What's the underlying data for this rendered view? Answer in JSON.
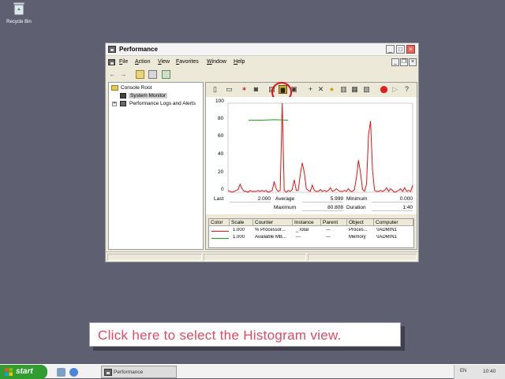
{
  "desktop": {
    "recycle_bin_label": "Recycle Bin"
  },
  "window": {
    "title": "Performance",
    "controls": {
      "minimize": "_",
      "maximize": "□",
      "close": "×"
    }
  },
  "menu": [
    "File",
    "Action",
    "View",
    "Favorites",
    "Window",
    "Help"
  ],
  "tree": {
    "root": "Console Root",
    "items": [
      "System Monitor",
      "Performance Logs and Alerts"
    ]
  },
  "chart": {
    "y_ticks": [
      "100",
      "80",
      "60",
      "40",
      "20",
      "0"
    ],
    "series_colors": {
      "processor": "#e81010",
      "memory": "#1aa31a"
    }
  },
  "chart_data": {
    "type": "line",
    "ylim": [
      0,
      100
    ],
    "series": [
      {
        "name": "% Processor...",
        "values": [
          2,
          1,
          0,
          1,
          2,
          3,
          9,
          4,
          1,
          1,
          0,
          2,
          1,
          1,
          1,
          2,
          1,
          2,
          1,
          2,
          0,
          1,
          2,
          12,
          4,
          1,
          2,
          100,
          2,
          0,
          2,
          1,
          3,
          14,
          2,
          2,
          20,
          33,
          22,
          4,
          2,
          1,
          8,
          2,
          1,
          1,
          3,
          1,
          2,
          1,
          2,
          5,
          1,
          2,
          4,
          2,
          1,
          1,
          2,
          1,
          4,
          1,
          1,
          3,
          17,
          36,
          22,
          3,
          1,
          9,
          64,
          80,
          25,
          2,
          1,
          1,
          2,
          1,
          2,
          5,
          1,
          4,
          2,
          0,
          1,
          2,
          4,
          1,
          5,
          1,
          2,
          1,
          8
        ]
      },
      {
        "name": "Available MB...",
        "values": [
          null,
          null,
          null,
          null,
          null,
          null,
          null,
          null,
          null,
          null,
          null,
          null,
          null,
          null,
          null,
          null,
          null,
          null,
          null,
          null,
          null,
          null,
          null,
          null,
          null,
          null,
          null,
          null,
          null,
          null,
          null,
          null,
          null,
          null,
          null,
          null,
          null,
          null,
          null,
          null,
          null,
          null,
          null,
          null,
          null,
          null,
          null,
          null,
          null,
          null,
          null,
          null,
          null,
          null,
          null,
          null,
          null,
          null,
          null,
          null,
          null,
          null,
          null,
          null,
          null,
          null,
          null,
          null,
          null,
          null,
          null,
          null,
          null,
          null,
          null,
          null,
          null,
          null,
          null,
          null,
          null,
          null,
          null,
          null,
          null,
          null,
          null,
          null,
          null,
          null,
          null,
          null,
          null
        ],
        "segment": [
          81,
          81,
          81.5,
          81
        ]
      }
    ]
  },
  "stats": {
    "last_label": "Last",
    "last_value": "2.000",
    "average_label": "Average",
    "average_value": "5.999",
    "minimum_label": "Minimum",
    "minimum_value": "0.000",
    "maximum_label": "Maximum",
    "maximum_value": "80.808",
    "duration_label": "Duration",
    "duration_value": "1:40"
  },
  "counters": {
    "headers": [
      "Color",
      "Scale",
      "Counter",
      "Instance",
      "Parent",
      "Object",
      "Computer"
    ],
    "rows": [
      {
        "color": "#e81010",
        "scale": "1.000",
        "counter": "% Processor...",
        "instance": "_Total",
        "parent": "---",
        "object": "Proces...",
        "computer": "\\\\ADMIN1"
      },
      {
        "color": "#1aa31a",
        "scale": "1.000",
        "counter": "Available MB...",
        "instance": "---",
        "parent": "---",
        "object": "Memory",
        "computer": "\\\\ADMIN1"
      }
    ]
  },
  "callout": {
    "text": "Click here to select the Histogram view."
  },
  "taskbar": {
    "start_label": "start",
    "task_label": "Performance",
    "language": "EN",
    "clock": "10:40"
  }
}
